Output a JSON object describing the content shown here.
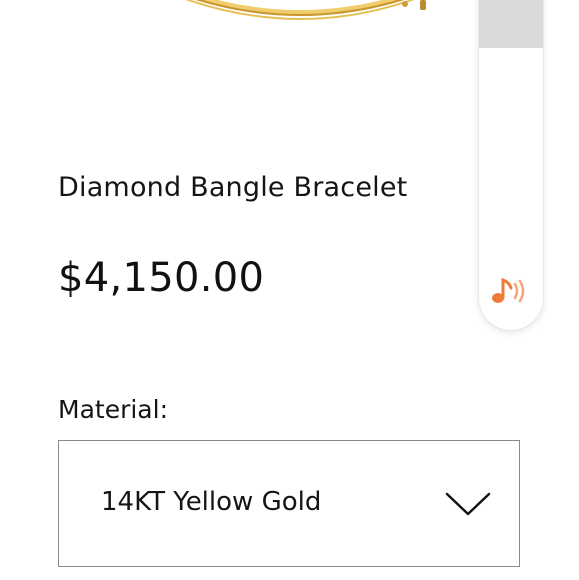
{
  "product": {
    "image_icon": "gold-bangle-bracelet-image",
    "title": "Diamond Bangle Bracelet",
    "price": "$4,150.00"
  },
  "options": {
    "material": {
      "label": "Material:",
      "selected": "14KT Yellow Gold",
      "chevron_icon": "chevron-down-icon"
    }
  },
  "widget": {
    "scrollbar_fraction_visible": 0.2,
    "audio_icon": "music-note-sound-icon",
    "accent_color": "#f07a3a"
  },
  "colors": {
    "gold": "#e2b54c",
    "text": "#151515",
    "border": "#8a8a8a"
  }
}
